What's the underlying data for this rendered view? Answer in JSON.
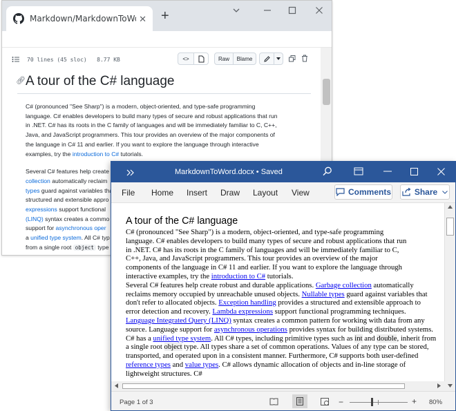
{
  "browser": {
    "tab_title": "Markdown/MarkdownToWord.md",
    "tab_close": "✕",
    "new_tab": "+",
    "file_meta": "70 lines (45 sloc)   8.77 KB",
    "raw_label": "Raw",
    "blame_label": "Blame",
    "heading": "A tour of the C# language",
    "p1": [
      "C# (pronounced \"See Sharp\") is a modern, object-oriented, and type-safe programming",
      "language. C# enables developers to build many types of secure and robust applications that run",
      "in .NET. C# has its roots in the C family of languages and will be immediately familiar to C, C++,",
      "Java, and JavaScript programmers. This tour provides an overview of the major components of",
      "the language in C# 11 and earlier. If you want to explore the language through interactive",
      "examples, try the ",
      "introduction to C#",
      " tutorials."
    ],
    "p2": [
      "Several C# features help create",
      "collection",
      " automatically reclaim",
      "types",
      " guard against variables that",
      "structured and extensible appro",
      "expressions",
      " support functional",
      "(LINQ)",
      " syntax creates a commo",
      "support for ",
      "asynchronous oper",
      "a ",
      "unified type system",
      ". All C# typ",
      "from a single root ",
      "object",
      " type"
    ]
  },
  "word": {
    "title": "MarkdownToWord.docx • Saved",
    "menu": [
      "File",
      "Home",
      "Insert",
      "Draw",
      "Layout",
      "View"
    ],
    "comments_label": "Comments",
    "share_label": "Share",
    "heading": "A tour of the C# language",
    "p1_lines": [
      "C# (pronounced \"See Sharp\") is a modern, object-oriented, and type-safe programming",
      "language. C# enables developers to build many types of secure and robust applications that run",
      "in .NET. C# has its roots in the C family of languages and will be immediately familiar to C,",
      "C++, Java, and JavaScript programmers. This tour provides an overview of the major",
      "components of the language in C# 11 and earlier. If you want to explore the language through",
      "interactive examples, try the "
    ],
    "p1_link": "introduction to C#",
    "p1_end": " tutorials.",
    "p2": {
      "t1": "Several C# features help create robust and durable applications. ",
      "l1": "Garbage collection",
      "t2": " automatically reclaims memory occupied by unreachable unused objects. ",
      "l2": "Nullable types",
      "t3": " guard against variables that don't refer to allocated objects. ",
      "l3": "Exception handling",
      "t4": " provides a structured and extensible approach to error detection and recovery. ",
      "l4": "Lambda expressions",
      "t5": " support functional programming techniques. ",
      "l5": "Language Integrated Query (LINQ)",
      "t6": " syntax creates a common pattern for working with data from any source. Language support for ",
      "l6": "asynchronous operations",
      "t7": " provides syntax for building distributed systems. C# has a ",
      "l7": "unified type system",
      "t8": ". All C# types, including primitive types such as ",
      "c1": "int",
      "t9": " and ",
      "c2": "double",
      "t10": ", inherit from a single root ",
      "c3": "object",
      "t11": " type. All types share a set of common operations. Values of any type can be stored, transported, and operated upon in a consistent manner. Furthermore, C# supports both user-defined ",
      "l8": "reference types",
      "t12": " and ",
      "l9": "value types",
      "t13": ". C# allows dynamic allocation of objects and in-line storage of lightweight structures. C#"
    },
    "page_info": "Page 1 of 3",
    "zoom_minus": "−",
    "zoom_plus": "+",
    "zoom": "80%"
  },
  "colors": {
    "word_blue": "#2b579a",
    "github_link": "#0969da",
    "word_link": "#0000ee"
  }
}
